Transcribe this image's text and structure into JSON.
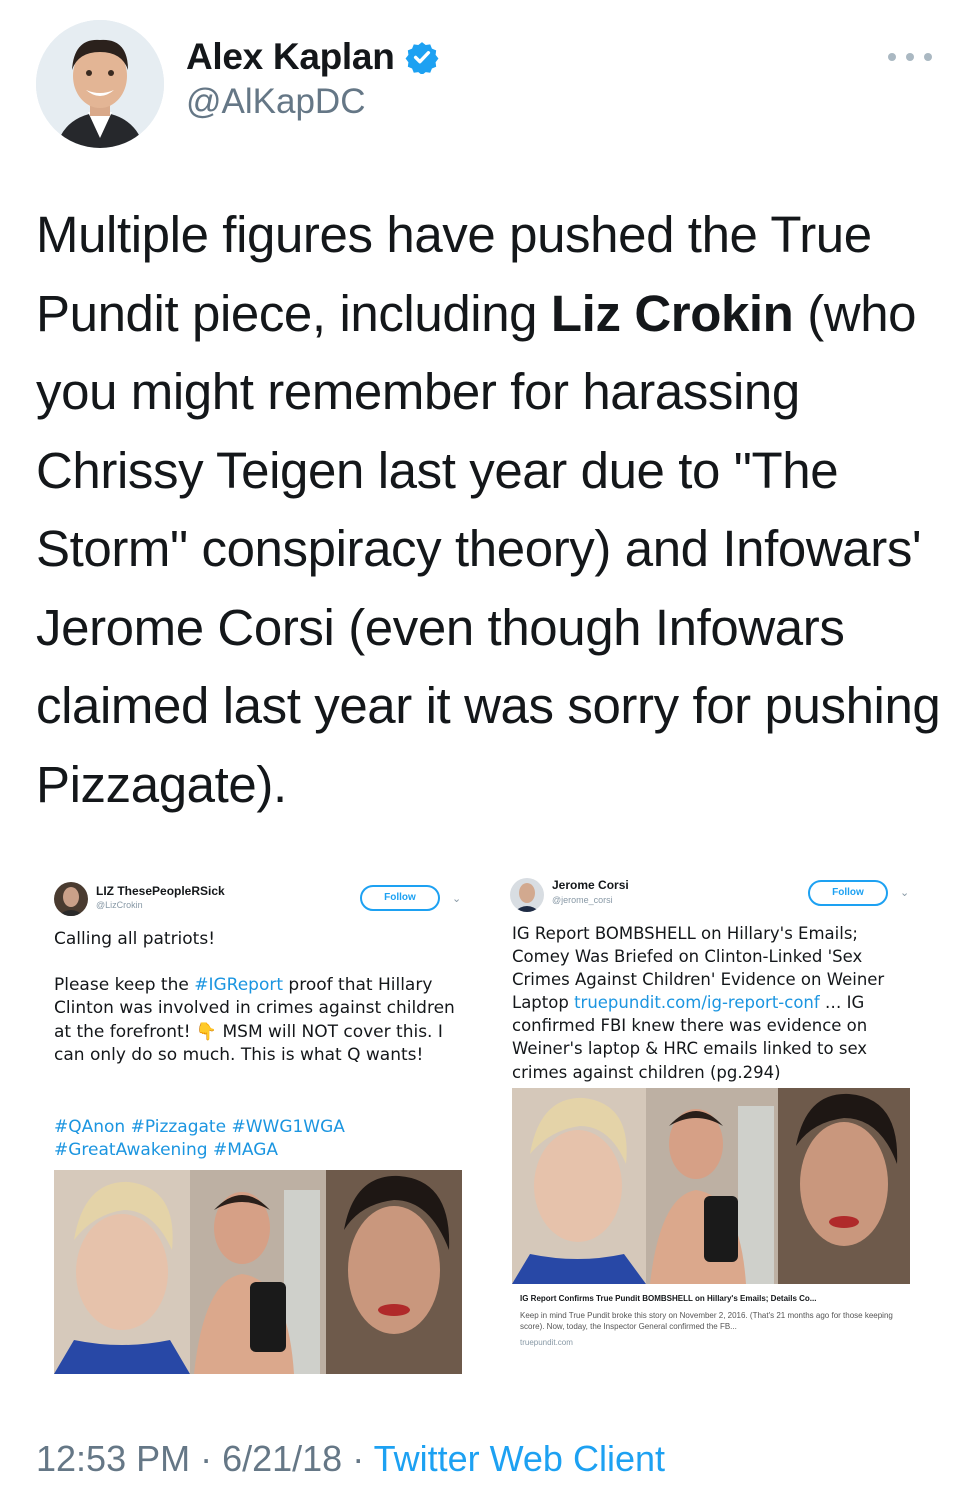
{
  "author": {
    "display_name": "Alex Kaplan",
    "handle": "@AlKapDC",
    "verified": true
  },
  "tweet": {
    "segments": [
      {
        "text": "Multiple figures have pushed the True Pundit piece, including ",
        "bold": false
      },
      {
        "text": "Liz Crokin",
        "bold": true
      },
      {
        "text": " (who you might remember for harassing Chrissy Teigen last year due to \"The Storm\" conspiracy theory) and Infowars' Jerome Corsi (even though Infowars claimed last year it was sorry for pushing Pizzagate).",
        "bold": false
      }
    ]
  },
  "embedded_left": {
    "name": "LIZ ThesePeopleRSick",
    "handle": "@LizCrokin",
    "follow_label": "Follow",
    "line1": "Calling all patriots!",
    "line2_pre": "Please keep the ",
    "line2_link": "#IGReport",
    "line2_post": " proof that Hillary Clinton was involved in crimes against children at the forefront! 👇 MSM will NOT cover this. I can only do so much. This is what Q wants!",
    "hashtags": "#QAnon #Pizzagate #WWG1WGA #GreatAwakening #MAGA"
  },
  "embedded_right": {
    "name": "Jerome Corsi",
    "handle": "@jerome_corsi",
    "follow_label": "Follow",
    "text_pre": "IG Report BOMBSHELL on Hillary's Emails; Comey Was Briefed on Clinton-Linked 'Sex Crimes Against Children' Evidence on Weiner Laptop ",
    "text_link": "truepundit.com/ig-report-conf",
    "text_post": " … IG confirmed FBI knew there was evidence on Weiner's laptop & HRC emails linked to sex crimes against children (pg.294)",
    "card_title": "IG Report Confirms True Pundit BOMBSHELL on Hillary's Emails; Details Co...",
    "card_description": "Keep in mind True Pundit broke this story on November 2, 2016. (That's 21 months ago for those keeping score). Now, today, the Inspector General confirmed the FB...",
    "card_domain": "truepundit.com"
  },
  "footer": {
    "time": "12:53 PM",
    "sep1": " · ",
    "date": "6/21/18",
    "sep2": " · ",
    "client": "Twitter Web Client"
  },
  "colors": {
    "accent": "#1da1f2",
    "link": "#1b95e0",
    "muted": "#657786",
    "text": "#14171a"
  }
}
